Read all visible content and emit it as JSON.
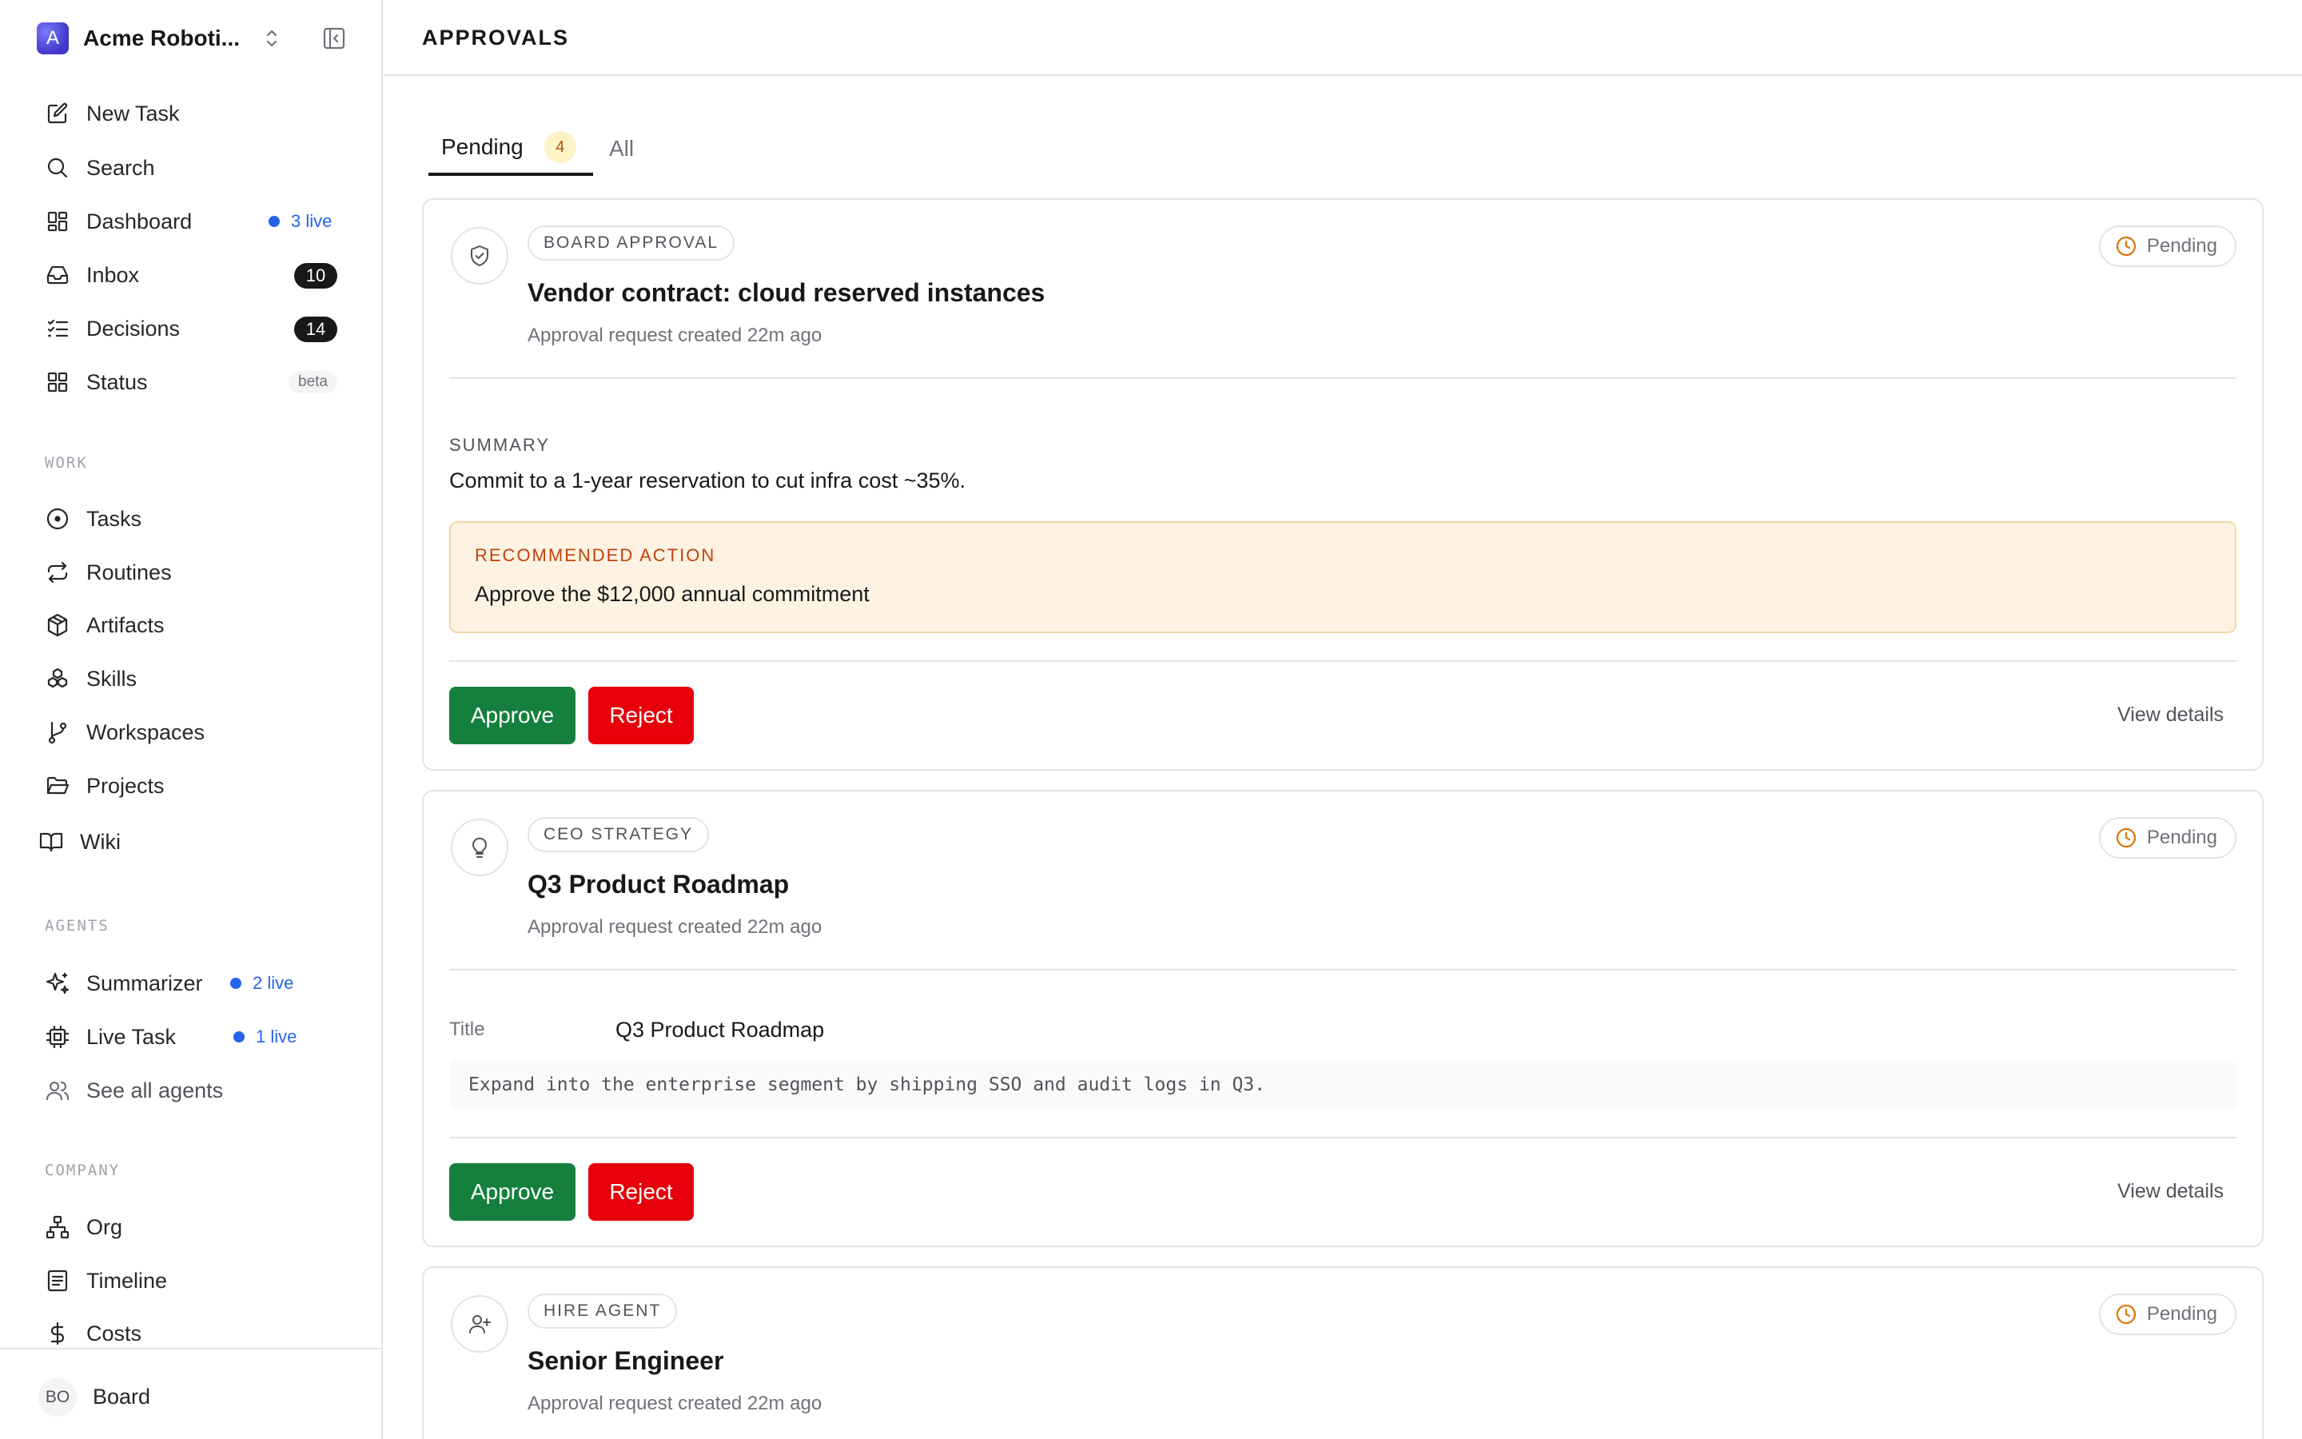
{
  "workspace": {
    "avatar_letter": "A",
    "name": "Acme Roboti..."
  },
  "nav": {
    "new_task": "New Task",
    "search": "Search",
    "dashboard": "Dashboard",
    "dashboard_live": "3 live",
    "inbox": "Inbox",
    "inbox_count": "10",
    "decisions": "Decisions",
    "decisions_count": "14",
    "status": "Status",
    "status_badge": "beta"
  },
  "sections": {
    "work": "WORK",
    "agents": "AGENTS",
    "company": "COMPANY"
  },
  "work": {
    "tasks": "Tasks",
    "routines": "Routines",
    "artifacts": "Artifacts",
    "skills": "Skills",
    "workspaces": "Workspaces",
    "projects": "Projects",
    "wiki": "Wiki"
  },
  "agents": {
    "summarizer": "Summarizer",
    "summarizer_live": "2 live",
    "live_task": "Live Task",
    "live_task_live": "1 live",
    "see_all": "See all agents"
  },
  "company": {
    "org": "Org",
    "timeline": "Timeline",
    "costs": "Costs"
  },
  "footer": {
    "avatar": "BO",
    "name": "Board"
  },
  "header": {
    "title": "APPROVALS"
  },
  "tabs": {
    "pending": "Pending",
    "pending_count": "4",
    "all": "All"
  },
  "cards": [
    {
      "tag": "BOARD APPROVAL",
      "title": "Vendor contract: cloud reserved instances",
      "subtitle": "Approval request created 22m ago",
      "status": "Pending",
      "summary_label": "SUMMARY",
      "summary": "Commit to a 1-year reservation to cut infra cost ~35%.",
      "rec_label": "RECOMMENDED ACTION",
      "rec_text": "Approve the $12,000 annual commitment",
      "approve": "Approve",
      "reject": "Reject",
      "view_details": "View details"
    },
    {
      "tag": "CEO STRATEGY",
      "title": "Q3 Product Roadmap",
      "subtitle": "Approval request created 22m ago",
      "status": "Pending",
      "field_label": "Title",
      "field_value": "Q3 Product Roadmap",
      "code": "Expand into the enterprise segment by shipping SSO and audit logs in Q3.",
      "approve": "Approve",
      "reject": "Reject",
      "view_details": "View details"
    },
    {
      "tag": "HIRE AGENT",
      "title": "Senior Engineer",
      "subtitle": "Approval request created 22m ago",
      "status": "Pending"
    }
  ],
  "colors": {
    "approve": "#15803d",
    "reject": "#e7000b",
    "live": "#2563eb",
    "pending_icon": "#d97706"
  }
}
